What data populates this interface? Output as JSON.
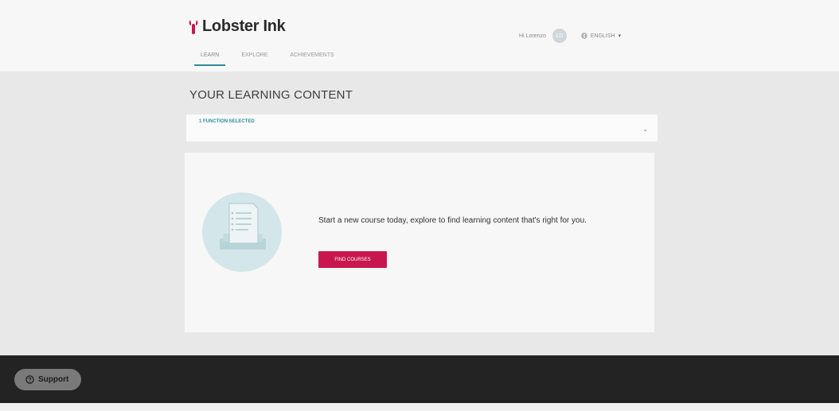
{
  "header": {
    "brand": "Lobster Ink",
    "tabs": [
      {
        "label": "LEARN",
        "active": true
      },
      {
        "label": "EXPLORE",
        "active": false
      },
      {
        "label": "ACHIEVEMENTS",
        "active": false
      }
    ],
    "greeting": "Hi Lorenzo",
    "avatar_initials": "LD",
    "language": "ENGLISH"
  },
  "main": {
    "title": "YOUR LEARNING CONTENT",
    "filter_label": "1 FUNCTION SELECTED",
    "empty_message": "Start a new course today, explore to find learning content that's right for you.",
    "find_courses_label": "FIND COURSES"
  },
  "footer": {
    "support_label": "Support"
  },
  "colors": {
    "brand_pink": "#c8174e",
    "accent_teal": "#2c8c9c",
    "footer_dark": "#232323"
  },
  "icons": [
    "lobster-logo-icon",
    "globe-icon",
    "chevron-down-icon",
    "help-circle-icon",
    "document-illustration"
  ]
}
